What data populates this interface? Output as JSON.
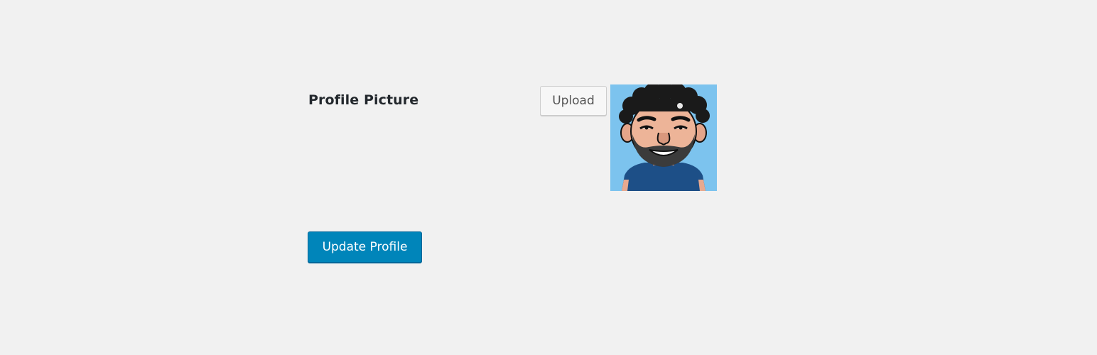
{
  "profile": {
    "label": "Profile Picture",
    "upload_label": "Upload",
    "avatar_alt": "avatar-illustration"
  },
  "actions": {
    "update_label": "Update Profile"
  },
  "colors": {
    "page_background": "#f1f1f1",
    "primary_button": "#0085ba",
    "avatar_background": "#7cc3ee"
  }
}
